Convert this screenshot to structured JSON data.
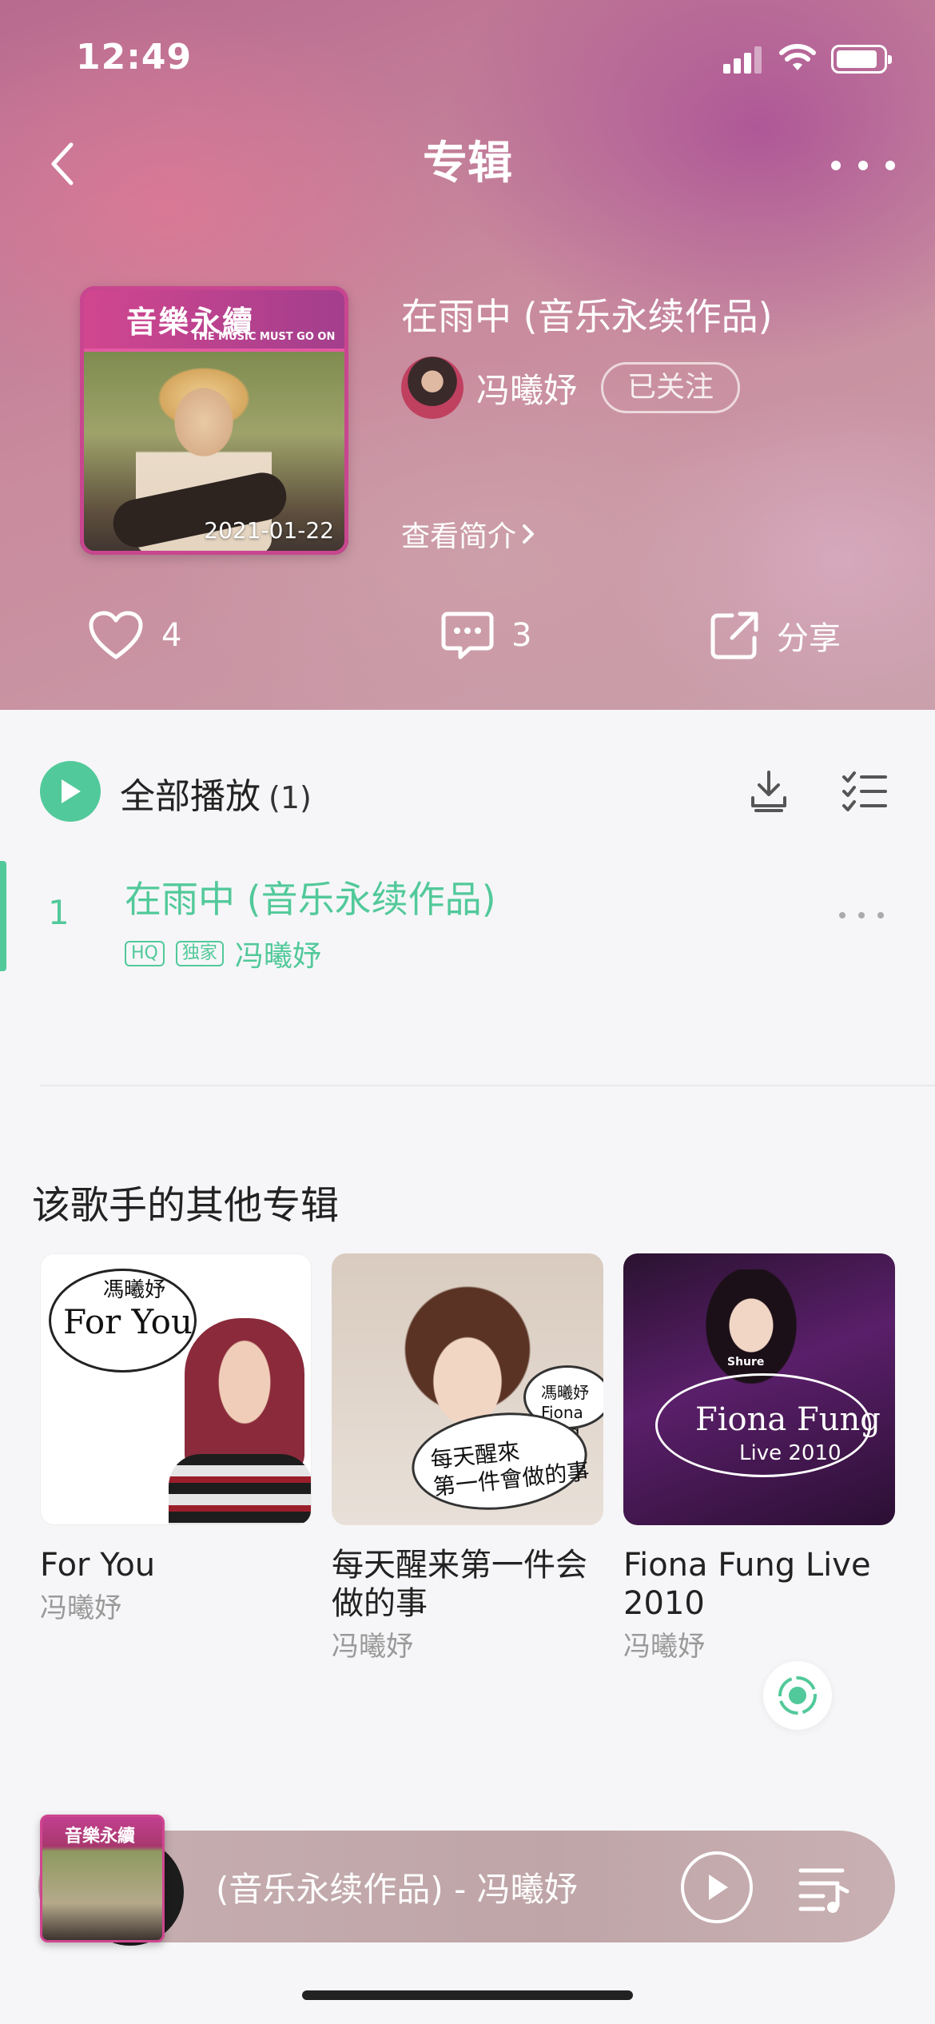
{
  "status_bar": {
    "time": "12:49"
  },
  "nav": {
    "title": "专辑"
  },
  "album": {
    "title": "在雨中 (音乐永续作品)",
    "cover_date": "2021-01-22",
    "cover_logo": "音樂永續",
    "cover_sub": "THE MUSIC MUST GO ON",
    "artist": "冯曦妤",
    "follow_label": "已关注",
    "intro_label": "查看简介"
  },
  "actions": {
    "likes": "4",
    "comments": "3",
    "share_label": "分享"
  },
  "playlist": {
    "play_all_label": "全部播放",
    "count": "(1)",
    "songs": [
      {
        "index": "1",
        "title": "在雨中 (音乐永续作品)",
        "tags": [
          "HQ",
          "独家"
        ],
        "artist": "冯曦妤"
      }
    ]
  },
  "other_albums": {
    "title": "该歌手的其他专辑",
    "items": [
      {
        "name": "For You",
        "artist": "冯曦妤",
        "art_text": "For You",
        "art_top": "馮曦妤"
      },
      {
        "name": "每天醒来第一件会做的事",
        "artist": "冯曦妤",
        "art_text": "每天醒來\n第一件會做的事",
        "art_top": "馮曦妤 Fiona Fung"
      },
      {
        "name": "Fiona Fung Live 2010",
        "artist": "冯曦妤",
        "art_text": "Fiona Fung",
        "art_sub": "Live 2010",
        "art_brand": "Shure"
      }
    ]
  },
  "mini_player": {
    "track": "(音乐永续作品) - 冯曦妤",
    "cover_logo": "音樂永續"
  },
  "colors": {
    "accent": "#52c99a",
    "text_muted": "#999999"
  },
  "icons": {
    "back": "chevron-left-icon",
    "more": "more-horizontal-icon",
    "like": "heart-icon",
    "comment": "comment-icon",
    "share": "share-icon",
    "download": "download-icon",
    "multiselect": "checklist-icon",
    "recognize": "record-icon",
    "playlist": "playlist-icon"
  }
}
